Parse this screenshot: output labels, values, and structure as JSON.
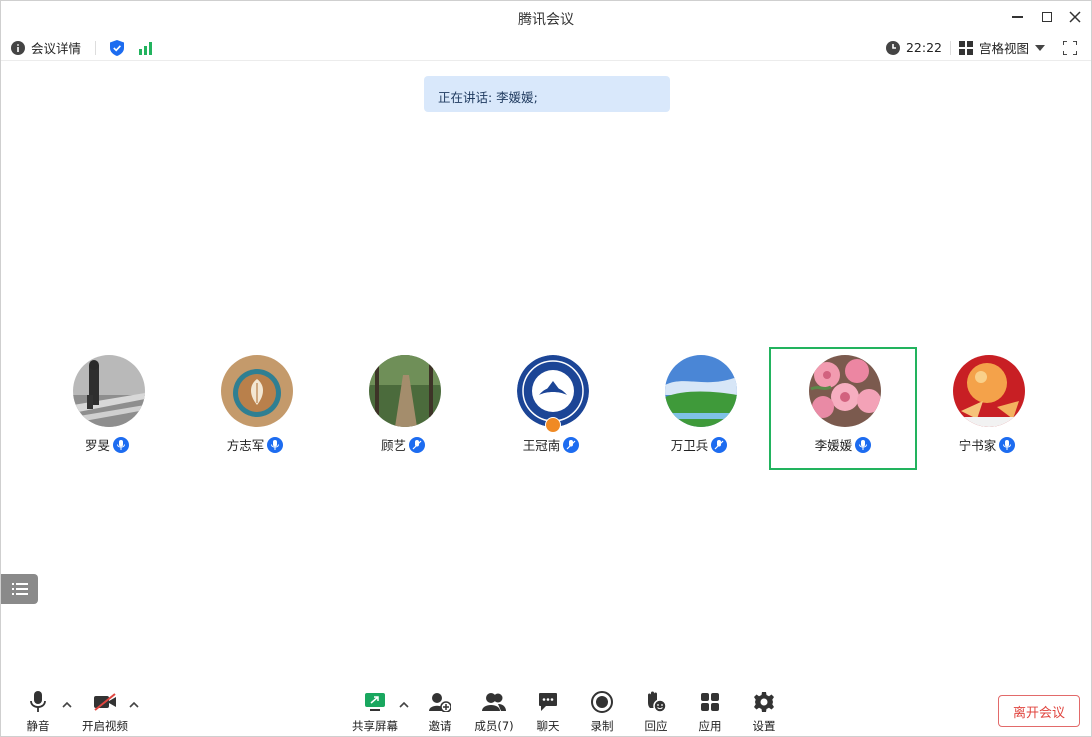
{
  "window": {
    "title": "腾讯会议"
  },
  "infobar": {
    "meeting_details": "会议详情",
    "time": "22:22",
    "view_mode": "宫格视图"
  },
  "speaking": {
    "text": "正在讲话: 李媛媛;"
  },
  "participants": [
    {
      "name": "罗旻",
      "mic": "on"
    },
    {
      "name": "方志军",
      "mic": "on"
    },
    {
      "name": "顾艺",
      "mic": "off"
    },
    {
      "name": "王冠南",
      "mic": "off",
      "host": true
    },
    {
      "name": "万卫兵",
      "mic": "off"
    },
    {
      "name": "李媛媛",
      "mic": "on",
      "speaking": true
    },
    {
      "name": "宁书家",
      "mic": "on"
    }
  ],
  "toolbar": {
    "mute": "静音",
    "video": "开启视频",
    "share": "共享屏幕",
    "invite": "邀请",
    "members": "成员(7)",
    "chat": "聊天",
    "record": "录制",
    "react": "回应",
    "apps": "应用",
    "settings": "设置",
    "leave": "离开会议"
  },
  "colors": {
    "accent": "#1d6cf0",
    "active_border": "#22b35e",
    "leave": "#e0453f",
    "share_green": "#1aa75f"
  }
}
